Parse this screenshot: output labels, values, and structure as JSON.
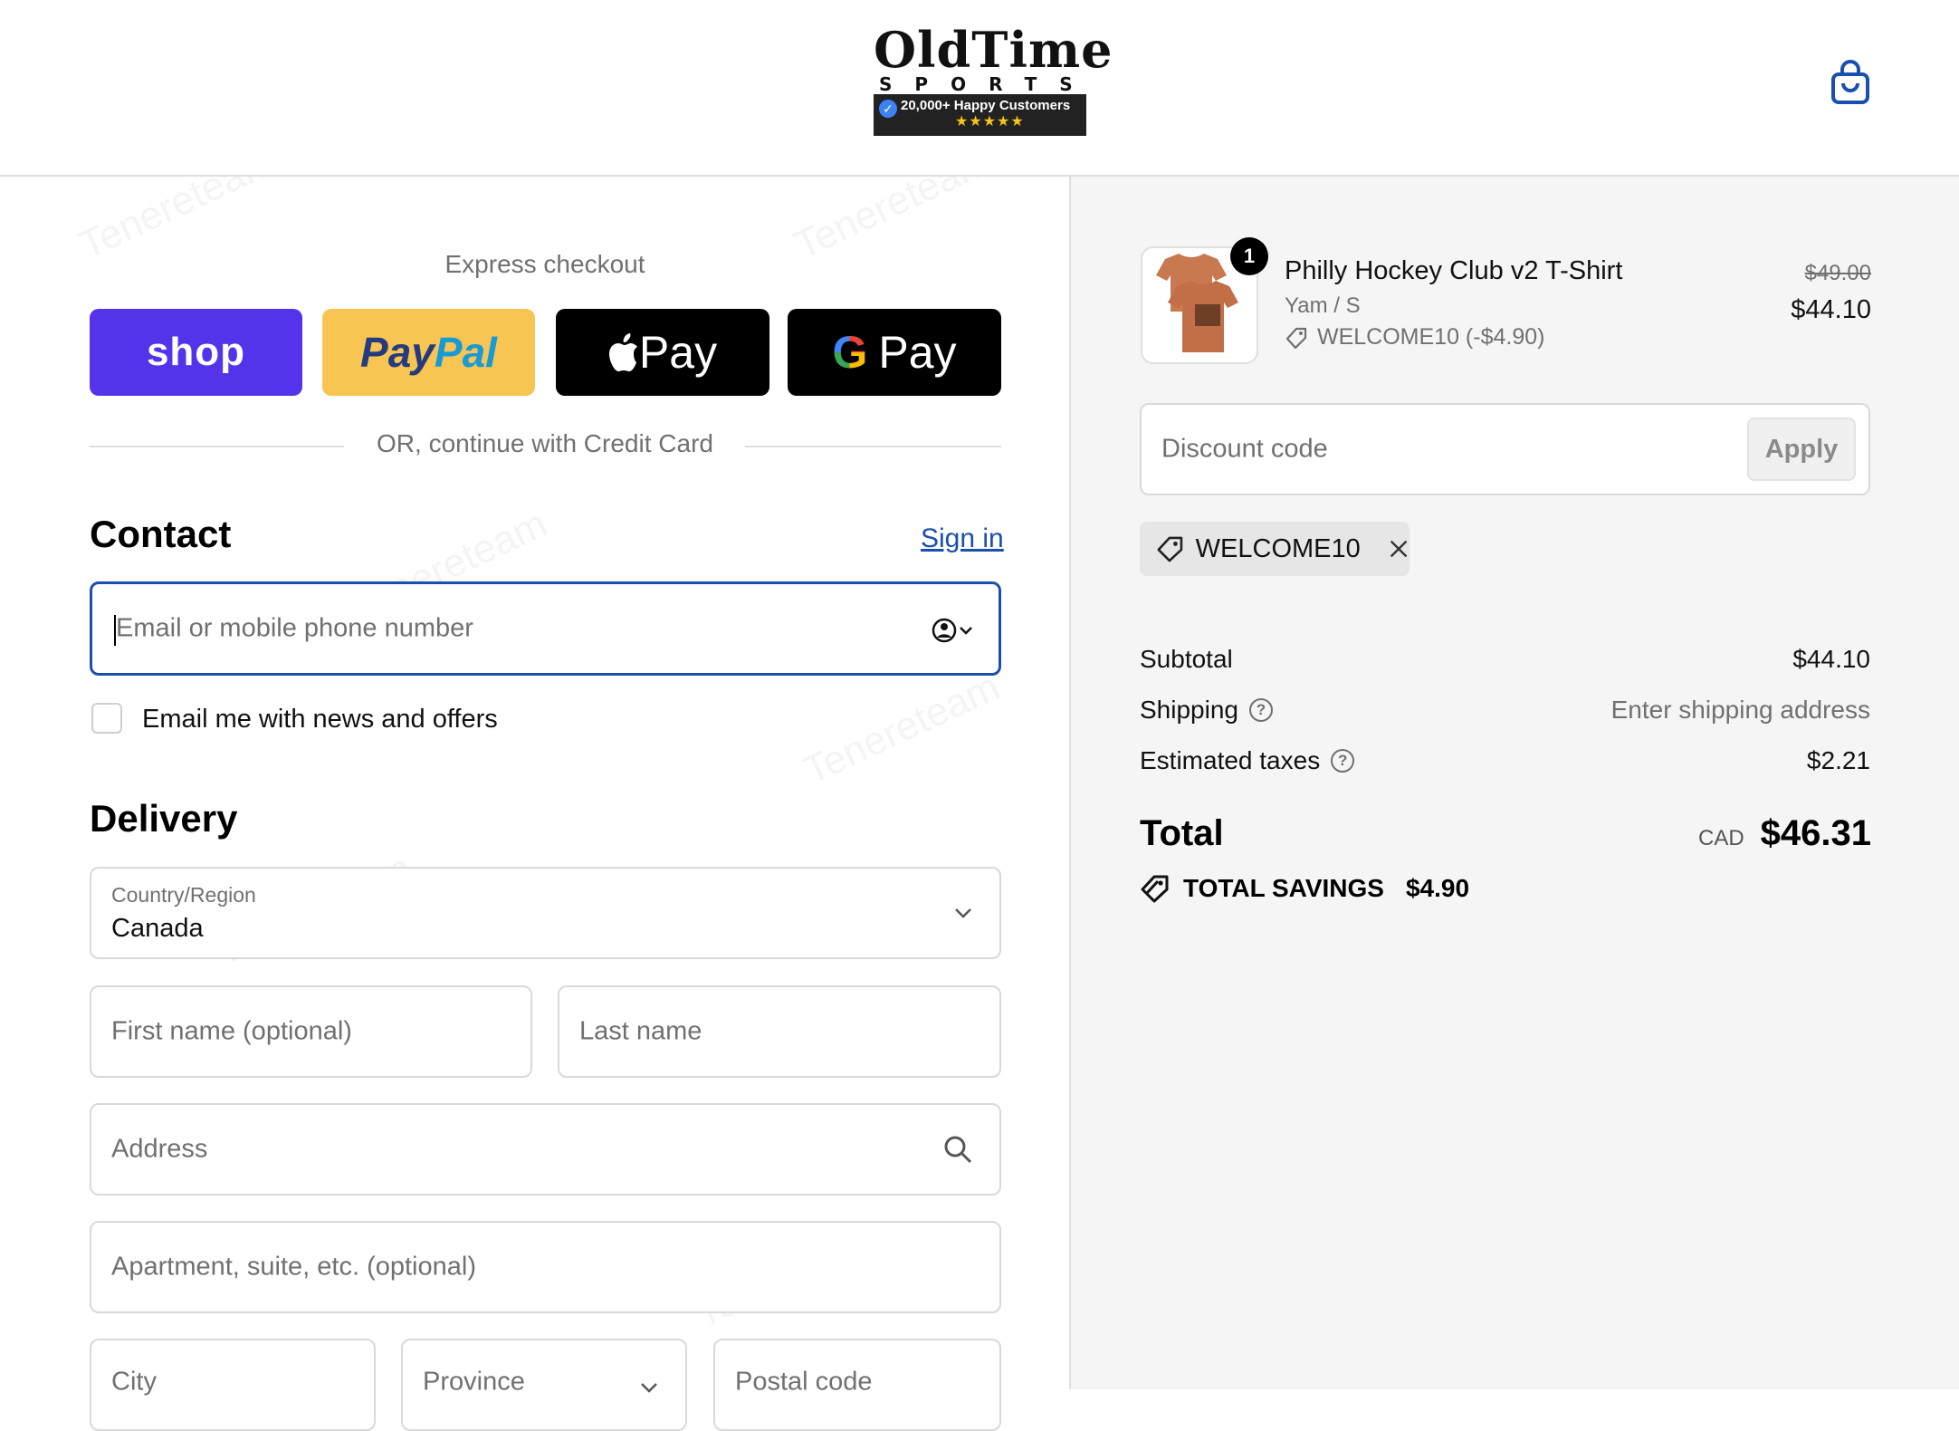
{
  "header": {
    "logo_title": "OldTime",
    "logo_sub": "SPORTS",
    "logo_badge": "20,000+ Happy Customers",
    "logo_stars": "★★★★★",
    "watermark": "Tenereteam"
  },
  "express": {
    "label": "Express checkout",
    "shop_label": "shop",
    "paypal_label_a": "Pay",
    "paypal_label_b": "Pal",
    "applepay_label": " Pay",
    "gpay_g": "G",
    "gpay_label": "Pay",
    "or_text": "OR, continue with Credit Card"
  },
  "contact": {
    "title": "Contact",
    "signin": "Sign in",
    "email_placeholder": "Email or mobile phone number",
    "newsletter_label": "Email me with news and offers"
  },
  "delivery": {
    "title": "Delivery",
    "country_label": "Country/Region",
    "country_value": "Canada",
    "first_name": "First name (optional)",
    "last_name": "Last name",
    "address": "Address",
    "apartment": "Apartment, suite, etc. (optional)",
    "city": "City",
    "province": "Province",
    "postal": "Postal code"
  },
  "summary": {
    "qty": "1",
    "product_name": "Philly Hockey Club v2 T-Shirt",
    "variant": "Yam / S",
    "product_discount": "WELCOME10 (-$4.90)",
    "price_old": "$49.00",
    "price_new": "$44.10",
    "discount_placeholder": "Discount code",
    "apply_label": "Apply",
    "coupon_code": "WELCOME10",
    "subtotal_label": "Subtotal",
    "subtotal_value": "$44.10",
    "shipping_label": "Shipping",
    "shipping_value": "Enter shipping address",
    "taxes_label": "Estimated taxes",
    "taxes_value": "$2.21",
    "total_label": "Total",
    "total_currency": "CAD",
    "total_value": "$46.31",
    "savings_label": "TOTAL SAVINGS",
    "savings_value": "$4.90"
  },
  "colors": {
    "accent": "#1a4fb0",
    "shop_pay": "#5433eb",
    "paypal": "#f8c552",
    "summary_bg": "#f5f5f5"
  }
}
